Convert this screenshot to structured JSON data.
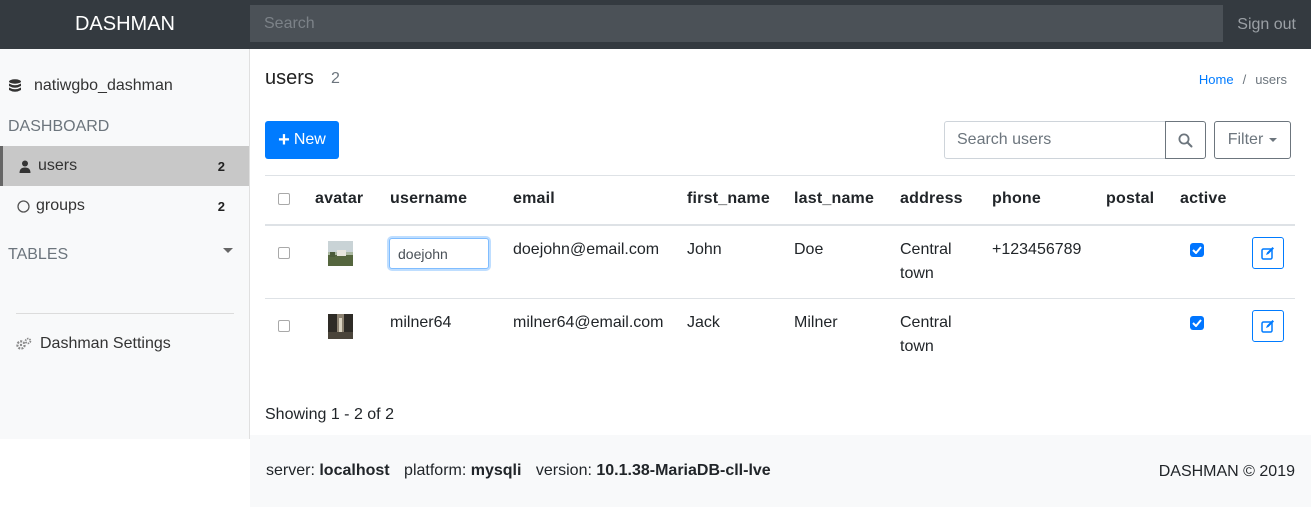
{
  "app": {
    "brand": "DASHMAN",
    "search_placeholder": "Search",
    "signout_label": "Sign out"
  },
  "sidebar": {
    "database": "natiwgbo_dashman",
    "dashboard_heading": "DASHBOARD",
    "items": [
      {
        "label": "users",
        "count": "2",
        "active": true
      },
      {
        "label": "groups",
        "count": "2",
        "active": false
      }
    ],
    "tables_heading": "TABLES",
    "settings_label": "Dashman Settings"
  },
  "main": {
    "title": "users",
    "count": "2",
    "breadcrumb": {
      "home": "Home",
      "separator": "/",
      "current": "users"
    },
    "new_button": "New",
    "search_placeholder": "Search users",
    "filter_label": "Filter"
  },
  "table": {
    "columns": [
      "avatar",
      "username",
      "email",
      "first_name",
      "last_name",
      "address",
      "phone",
      "postal",
      "active"
    ],
    "rows": [
      {
        "username": "doejohn",
        "email": "doejohn@email.com",
        "first_name": "John",
        "last_name": "Doe",
        "address_line1": "Central",
        "address_line2": "town",
        "phone": "+123456789",
        "postal": "",
        "active": true
      },
      {
        "username": "milner64",
        "email": "milner64@email.com",
        "first_name": "Jack",
        "last_name": "Milner",
        "address_line1": "Central",
        "address_line2": "town",
        "phone": "",
        "postal": "",
        "active": true
      }
    ]
  },
  "pagination": {
    "summary": "Showing 1 - 2 of 2"
  },
  "footer": {
    "server_label": "server:",
    "server_value": "localhost",
    "platform_label": "platform:",
    "platform_value": "mysqli",
    "version_label": "version:",
    "version_value": "10.1.38-MariaDB-cll-lve",
    "copyright": "DASHMAN © 2019"
  },
  "colors": {
    "navbar": "#343a40",
    "primary": "#007bff",
    "sidebar_bg": "#f8f9fa",
    "active_item": "#c8c8c8"
  }
}
